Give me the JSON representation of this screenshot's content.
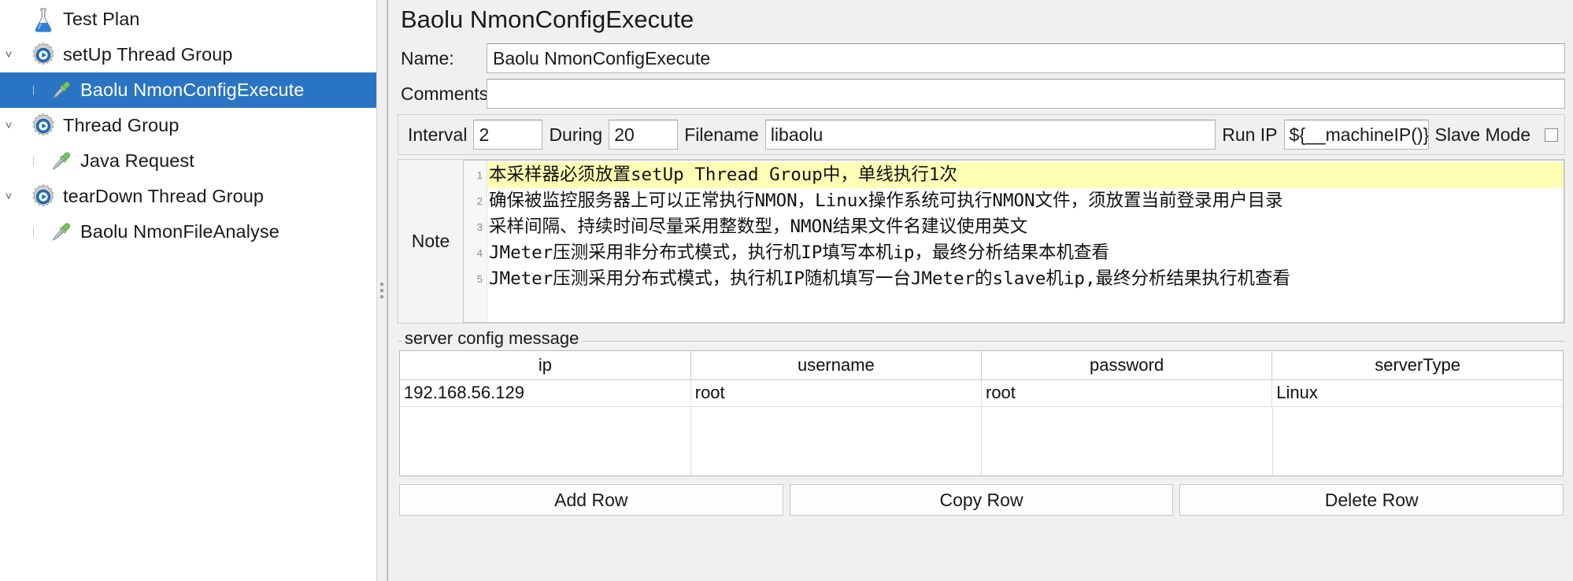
{
  "tree": {
    "items": [
      {
        "label": "Test Plan",
        "icon": "flask-icon",
        "level": 0,
        "twisty": "",
        "selected": false
      },
      {
        "label": "setUp Thread Group",
        "icon": "thread-group-icon",
        "level": 0,
        "twisty": "˅",
        "selected": false
      },
      {
        "label": "Baolu NmonConfigExecute",
        "icon": "sampler-icon",
        "level": 2,
        "twisty": "",
        "selected": true
      },
      {
        "label": "Thread Group",
        "icon": "thread-group-icon",
        "level": 0,
        "twisty": "˅",
        "selected": false
      },
      {
        "label": "Java Request",
        "icon": "sampler-icon",
        "level": 2,
        "twisty": "",
        "selected": false
      },
      {
        "label": "tearDown Thread Group",
        "icon": "thread-group-icon",
        "level": 0,
        "twisty": "˅",
        "selected": false
      },
      {
        "label": "Baolu NmonFileAnalyse",
        "icon": "sampler-icon",
        "level": 2,
        "twisty": "",
        "selected": false
      }
    ]
  },
  "header": {
    "title": "Baolu NmonConfigExecute"
  },
  "form": {
    "name_label": "Name:",
    "name_value": "Baolu NmonConfigExecute",
    "comments_label": "Comments:",
    "comments_value": ""
  },
  "config": {
    "interval_label": "Interval",
    "interval_value": "2",
    "during_label": "During",
    "during_value": "20",
    "filename_label": "Filename",
    "filename_value": "libaolu",
    "runip_label": "Run IP",
    "runip_value": "${__machineIP()}",
    "slave_label": "Slave Mode",
    "slave_checked": false
  },
  "note": {
    "label": "Note",
    "lines": [
      {
        "n": "1",
        "text": "本采样器必须放置setUp Thread Group中，单线执行1次",
        "highlight": true
      },
      {
        "n": "2",
        "text": "确保被监控服务器上可以正常执行NMON，Linux操作系统可执行NMON文件，须放置当前登录用户目录",
        "highlight": false
      },
      {
        "n": "3",
        "text": "采样间隔、持续时间尽量采用整数型，NMON结果文件名建议使用英文",
        "highlight": false
      },
      {
        "n": "4",
        "text": "JMeter压测采用非分布式模式，执行机IP填写本机ip，最终分析结果本机查看",
        "highlight": false
      },
      {
        "n": "5",
        "text": "JMeter压测采用分布式模式，执行机IP随机填写一台JMeter的slave机ip,最终分析结果执行机查看",
        "highlight": false
      }
    ]
  },
  "server_config": {
    "group_title": "server config message",
    "columns": [
      "ip",
      "username",
      "password",
      "serverType"
    ],
    "rows": [
      {
        "ip": "192.168.56.129",
        "username": "root",
        "password": "root",
        "serverType": "Linux"
      }
    ]
  },
  "buttons": {
    "add_row": "Add Row",
    "copy_row": "Copy Row",
    "delete_row": "Delete Row"
  },
  "colors": {
    "selection": "#2a74c4",
    "highlight": "#feffb5",
    "panel": "#f0f0f0"
  }
}
